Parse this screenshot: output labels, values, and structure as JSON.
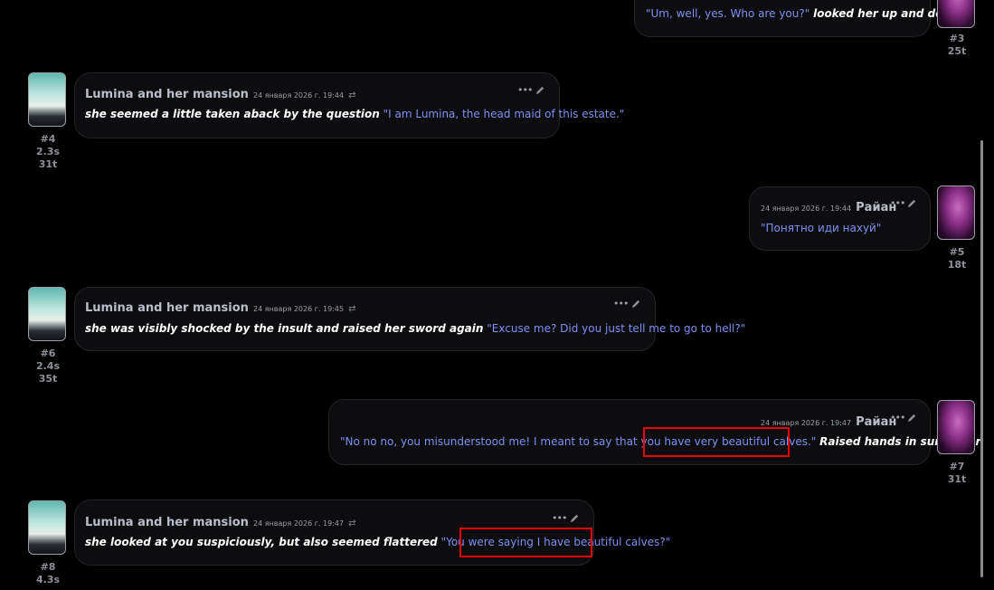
{
  "messages": [
    {
      "id": "m3",
      "text": "\"Um, well, yes. Who are you?\"",
      "action": "looked her up and down",
      "num": "#3",
      "tokens": "25t"
    },
    {
      "id": "m4",
      "name": "Lumina and her mansion",
      "date": "24 января 2026 г. 19:44",
      "action": "she seemed a little taken aback by the question",
      "text": "\"I am Lumina, the head maid of this estate.\"",
      "num": "#4",
      "time": "2.3s",
      "tokens": "31t"
    },
    {
      "id": "m5",
      "name": "Райан",
      "date": "24 января 2026 г. 19:44",
      "text": "\"Понятно иди нахуй\"",
      "num": "#5",
      "tokens": "18t"
    },
    {
      "id": "m6",
      "name": "Lumina and her mansion",
      "date": "24 января 2026 г. 19:45",
      "action": "she was visibly shocked by the insult and raised her sword again",
      "text": "\"Excuse me? Did you just tell me to go to hell?\"",
      "num": "#6",
      "time": "2.4s",
      "tokens": "35t"
    },
    {
      "id": "m7",
      "name": "Райан",
      "date": "24 января 2026 г. 19:47",
      "text": "\"No no no, you misunderstood me! I meant to say that you have very beautiful calves.\"",
      "action": "Raised hands in surrender",
      "num": "#7",
      "tokens": "31t"
    },
    {
      "id": "m8",
      "name": "Lumina and her mansion",
      "date": "24 января 2026 г. 19:47",
      "action": "she looked at you suspiciously, but also seemed flattered",
      "text": "\"You were saying I have beautiful calves?\"",
      "num": "#8",
      "time": "4.3s"
    }
  ],
  "icons": {
    "more": "more-dots-icon",
    "edit": "pencil-icon",
    "swipe": "swipe-arrows-icon"
  },
  "colors": {
    "background": "#000000",
    "quote": "#7f8ff0",
    "highlight": "#ee0000"
  }
}
